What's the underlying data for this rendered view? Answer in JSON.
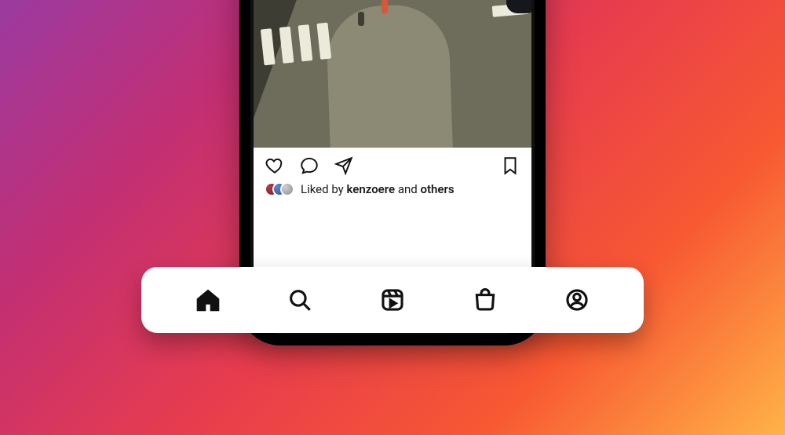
{
  "post": {
    "actions": {
      "like": "like-icon",
      "comment": "comment-icon",
      "share": "share-icon",
      "save": "bookmark-icon"
    },
    "likes": {
      "prefix": "Liked by",
      "user": "kenzoere",
      "joiner": "and",
      "suffix": "others"
    }
  },
  "nav": {
    "items": [
      {
        "name": "home-tab",
        "icon": "home-icon",
        "active": true
      },
      {
        "name": "search-tab",
        "icon": "search-icon",
        "active": false
      },
      {
        "name": "reels-tab",
        "icon": "reels-icon",
        "active": false
      },
      {
        "name": "shop-tab",
        "icon": "shop-icon",
        "active": false
      },
      {
        "name": "profile-tab",
        "icon": "profile-icon",
        "active": false
      }
    ]
  }
}
